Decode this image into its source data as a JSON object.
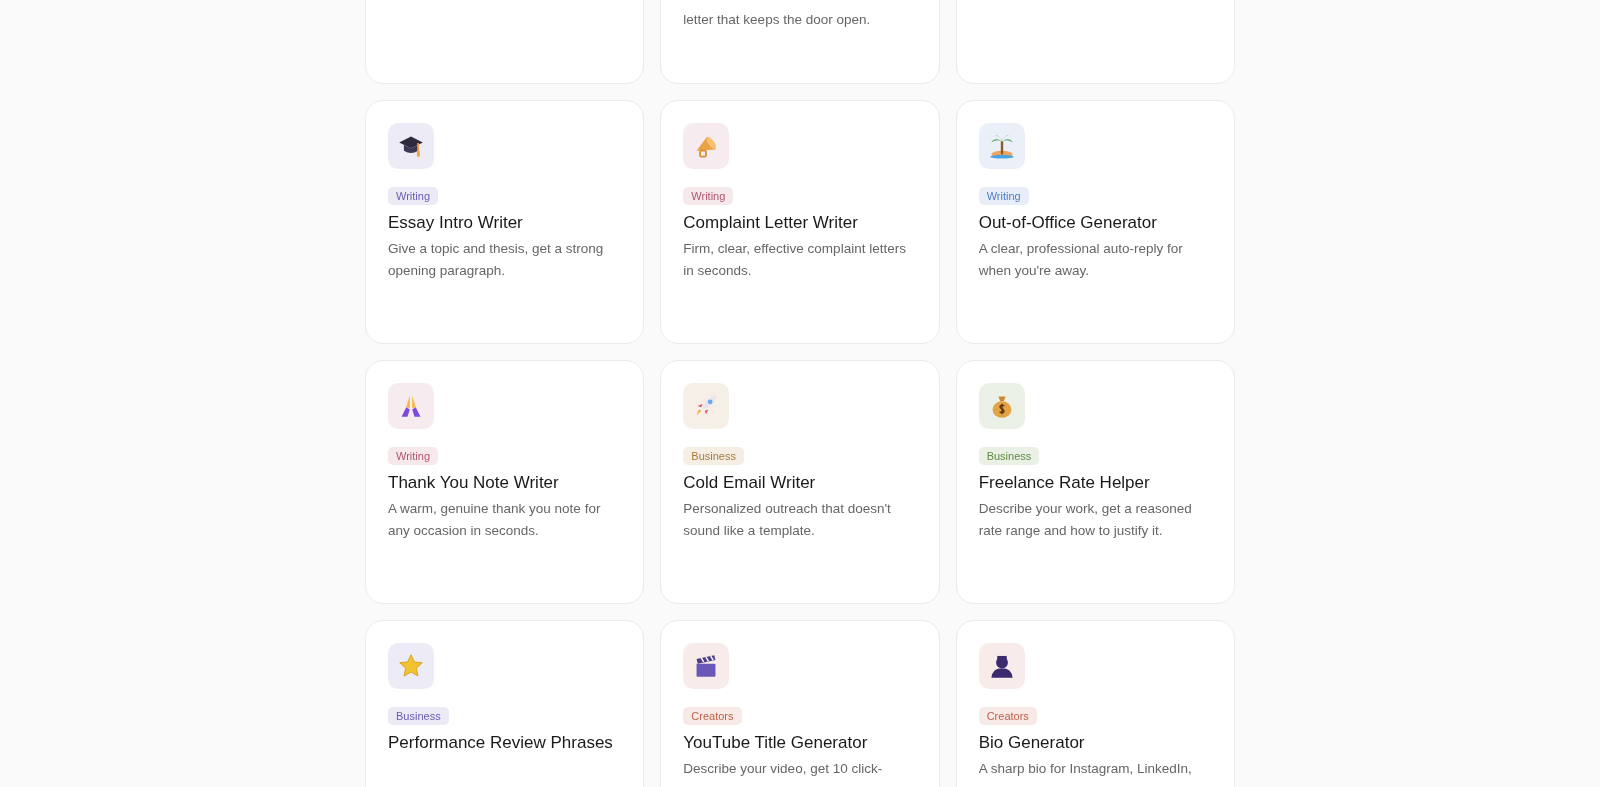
{
  "cards": [
    {
      "kind": "partial"
    },
    {
      "kind": "partial",
      "description": "letter that keeps the door open."
    },
    {
      "kind": "partial"
    },
    {
      "kind": "full",
      "tag": "Writing",
      "color": "#6b5bb5",
      "title": "Essay Intro Writer",
      "description": "Give a topic and thesis, get a strong opening paragraph."
    },
    {
      "kind": "full",
      "tag": "Writing",
      "color": "#b0566f",
      "title": "Complaint Letter Writer",
      "description": "Firm, clear, effective complaint letters in seconds."
    },
    {
      "kind": "full",
      "tag": "Writing",
      "color": "#4f7cc4",
      "title": "Out-of-Office Generator",
      "description": "A clear, professional auto-reply for when you're away."
    },
    {
      "kind": "full",
      "tag": "Writing",
      "color": "#b0566f",
      "title": "Thank You Note Writer",
      "description": "A warm, genuine thank you note for any occasion in seconds."
    },
    {
      "kind": "full",
      "tag": "Business",
      "color": "#a87a3a",
      "title": "Cold Email Writer",
      "description": "Personalized outreach that doesn't sound like a template."
    },
    {
      "kind": "full",
      "tag": "Business",
      "color": "#5f8a42",
      "title": "Freelance Rate Helper",
      "description": "Describe your work, get a reasoned rate range and how to justify it."
    },
    {
      "kind": "full",
      "tag": "Business",
      "color": "#6b5bb5",
      "title": "Performance Review Phrases"
    },
    {
      "kind": "full",
      "tag": "Creators",
      "color": "#c0604a",
      "title": "YouTube Title Generator",
      "description": "Describe your video, get 10 click-"
    },
    {
      "kind": "full",
      "tag": "Creators",
      "color": "#c0604a",
      "title": "Bio Generator",
      "description": "A sharp bio for Instagram, LinkedIn,"
    }
  ]
}
